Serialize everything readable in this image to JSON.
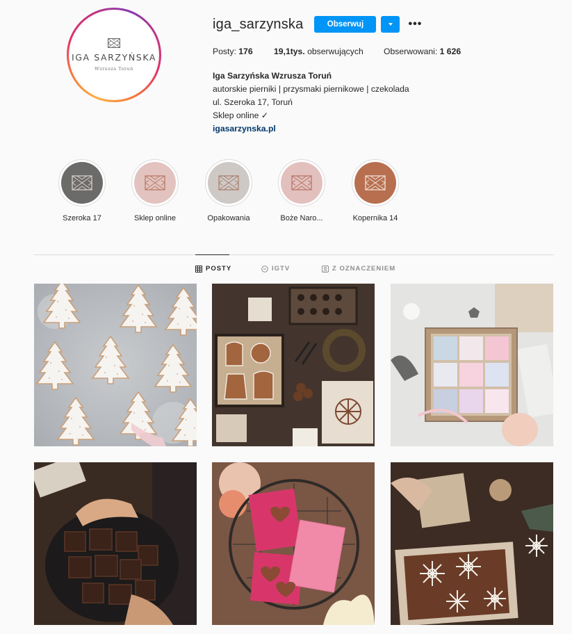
{
  "profile": {
    "username": "iga_sarzynska",
    "follow_label": "Obserwuj",
    "avatar": {
      "brand_name": "IGA SARZYŃSKA",
      "brand_sub": "Wzrusza Toruń"
    }
  },
  "stats": {
    "posts_label": "Posty:",
    "posts_value": "176",
    "followers_value": "19,1tys.",
    "followers_label": "obserwujących",
    "following_label": "Obserwowani:",
    "following_value": "1 626"
  },
  "bio": {
    "name": "Iga Sarzyńska Wzrusza Toruń",
    "lines": [
      "autorskie pierniki | przysmaki piernikowe | czekolada",
      "ul. Szeroka 17, Toruń",
      "Sklep online ✓"
    ],
    "link": "igasarzynska.pl"
  },
  "highlights": [
    {
      "label": "Szeroka 17",
      "color": "#6b6b69"
    },
    {
      "label": "Sklep online",
      "color": "#e2c3bf"
    },
    {
      "label": "Opakowania",
      "color": "#cfc9c6"
    },
    {
      "label": "Boże Naro...",
      "color": "#e2c0bd"
    },
    {
      "label": "Kopernika 14",
      "color": "#b86f4f"
    }
  ],
  "tabs": [
    {
      "label": "POSTY",
      "icon": "grid-icon",
      "active": true
    },
    {
      "label": "IGTV",
      "icon": "igtv-icon",
      "active": false
    },
    {
      "label": "Z OZNACZENIEM",
      "icon": "tagged-icon",
      "active": false
    }
  ],
  "posts": [
    {
      "subject": "white gingerbread christmas trees"
    },
    {
      "subject": "gingerbread figures in wooden boxes"
    },
    {
      "subject": "gift box with pastel gingerbread tiles"
    },
    {
      "subject": "chocolate brownies on dark plate"
    },
    {
      "subject": "pink chocolate bars with hearts"
    },
    {
      "subject": "snowflake gingerbread in paper box"
    }
  ],
  "colors": {
    "accent": "#0095f6",
    "link": "#00376b",
    "text": "#262626",
    "muted": "#8e8e8e",
    "border": "#dbdbdb",
    "background": "#fafafa"
  }
}
